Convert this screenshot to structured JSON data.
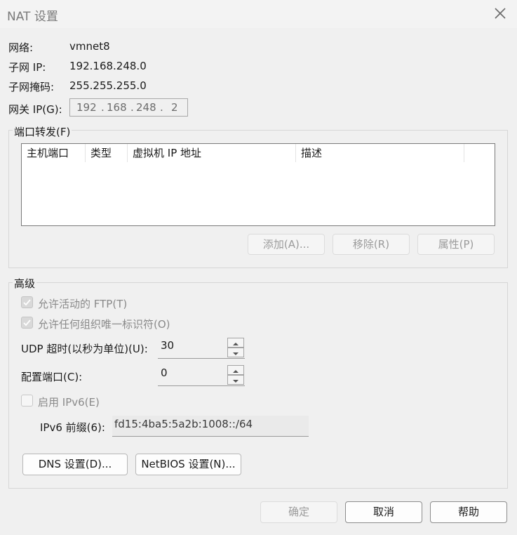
{
  "window": {
    "title": "NAT 设置"
  },
  "info": {
    "network_label": "网络:",
    "network_value": "vmnet8",
    "subnet_ip_label": "子网 IP:",
    "subnet_ip_value": "192.168.248.0",
    "subnet_mask_label": "子网掩码:",
    "subnet_mask_value": "255.255.255.0",
    "gateway_label": "网关 IP(G):",
    "gateway_octets": [
      "192",
      "168",
      "248",
      "2"
    ]
  },
  "port_forwarding": {
    "title": "端口转发(F)",
    "columns": [
      "主机端口",
      "类型",
      "虚拟机 IP 地址",
      "描述"
    ],
    "rows": [],
    "add_label": "添加(A)...",
    "remove_label": "移除(R)",
    "properties_label": "属性(P)"
  },
  "advanced": {
    "title": "高级",
    "allow_ftp_label": "允许活动的 FTP(T)",
    "allow_ftp_checked": true,
    "allow_uuid_label": "允许任何组织唯一标识符(O)",
    "allow_uuid_checked": true,
    "udp_timeout_label": "UDP 超时(以秒为单位)(U):",
    "udp_timeout_value": "30",
    "config_port_label": "配置端口(C):",
    "config_port_value": "0",
    "enable_ipv6_label": "启用 IPv6(E)",
    "enable_ipv6_checked": false,
    "ipv6_prefix_label": "IPv6 前缀(6):",
    "ipv6_prefix_value": "fd15:4ba5:5a2b:1008::/64",
    "dns_button": "DNS 设置(D)...",
    "netbios_button": "NetBIOS 设置(N)..."
  },
  "footer": {
    "ok_label": "确定",
    "cancel_label": "取消",
    "help_label": "帮助"
  },
  "icons": {
    "close": "close-icon",
    "checkmark": "checkmark-icon",
    "spin_up": "chevron-up-icon",
    "spin_down": "chevron-down-icon"
  },
  "colors": {
    "window_bg": "#f0f0f0",
    "disabled_text": "#9b9b9b",
    "list_bg": "#ffffff"
  }
}
